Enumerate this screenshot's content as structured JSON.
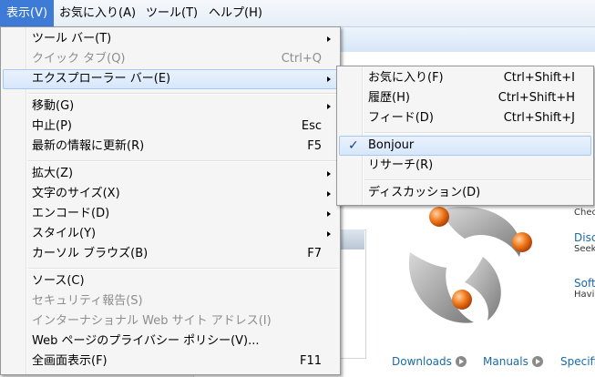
{
  "menubar": {
    "items": [
      "表示(V)",
      "お気に入り(A)",
      "ツール(T)",
      "ヘルプ(H)"
    ]
  },
  "view_menu": {
    "items": [
      {
        "label": "ツール バー(T)",
        "shortcut": "",
        "submenu": true,
        "disabled": false
      },
      {
        "label": "クイック タブ(Q)",
        "shortcut": "Ctrl+Q",
        "submenu": false,
        "disabled": true
      },
      {
        "label": "エクスプローラー バー(E)",
        "shortcut": "",
        "submenu": true,
        "disabled": false,
        "highlighted": true
      },
      {
        "label": "移動(G)",
        "shortcut": "",
        "submenu": true,
        "disabled": false
      },
      {
        "label": "中止(P)",
        "shortcut": "Esc",
        "submenu": false,
        "disabled": false
      },
      {
        "label": "最新の情報に更新(R)",
        "shortcut": "F5",
        "submenu": false,
        "disabled": false
      },
      {
        "label": "拡大(Z)",
        "shortcut": "",
        "submenu": true,
        "disabled": false
      },
      {
        "label": "文字のサイズ(X)",
        "shortcut": "",
        "submenu": true,
        "disabled": false
      },
      {
        "label": "エンコード(D)",
        "shortcut": "",
        "submenu": true,
        "disabled": false
      },
      {
        "label": "スタイル(Y)",
        "shortcut": "",
        "submenu": true,
        "disabled": false
      },
      {
        "label": "カーソル ブラウズ(B)",
        "shortcut": "F7",
        "submenu": false,
        "disabled": false
      },
      {
        "label": "ソース(C)",
        "shortcut": "",
        "submenu": false,
        "disabled": false
      },
      {
        "label": "セキュリティ報告(S)",
        "shortcut": "",
        "submenu": false,
        "disabled": true
      },
      {
        "label": "インターナショナル Web サイト アドレス(I)",
        "shortcut": "",
        "submenu": true,
        "disabled": true
      },
      {
        "label": "Web ページのプライバシー ポリシー(V)...",
        "shortcut": "",
        "submenu": false,
        "disabled": false
      },
      {
        "label": "全画面表示(F)",
        "shortcut": "F11",
        "submenu": false,
        "disabled": false
      }
    ]
  },
  "explorer_submenu": {
    "items": [
      {
        "label": "お気に入り(F)",
        "shortcut": "Ctrl+Shift+I",
        "checked": false
      },
      {
        "label": "履歴(H)",
        "shortcut": "Ctrl+Shift+H",
        "checked": false
      },
      {
        "label": "フィード(D)",
        "shortcut": "Ctrl+Shift+J",
        "checked": false
      },
      {
        "label": "Bonjour",
        "shortcut": "",
        "checked": true,
        "highlighted": true
      },
      {
        "label": "リサーチ(R)",
        "shortcut": "",
        "checked": false
      },
      {
        "label": "ディスカッション(D)",
        "shortcut": "",
        "checked": false
      }
    ],
    "check_glyph": "✓"
  },
  "page": {
    "side": [
      {
        "title": "",
        "sub": "Chec"
      },
      {
        "title": "Disc",
        "sub": "Seek"
      },
      {
        "title": "Soft",
        "sub": "Havi"
      }
    ],
    "footer_links": [
      "Downloads",
      "Manuals",
      "Specific"
    ]
  },
  "colors": {
    "menubar_active": "#3d7bd6",
    "link": "#1a6aa8",
    "logo_orb": "#f07a1c"
  }
}
